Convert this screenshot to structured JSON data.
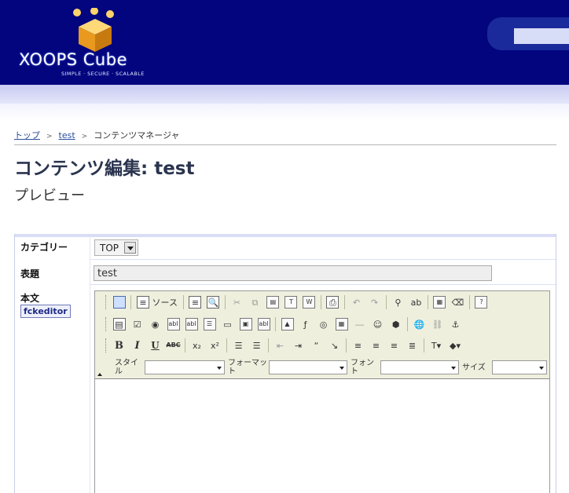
{
  "header": {
    "logo_text": "XOOPS Cube",
    "logo_tagline": "SIMPLE · SECURE · SCALABLE"
  },
  "breadcrumb": {
    "items": [
      "トップ",
      "test",
      "コンテンツマネージャ"
    ],
    "separator": ">"
  },
  "page": {
    "title": "コンテンツ編集: test",
    "subtitle": "プレビュー"
  },
  "form": {
    "category_label": "カテゴリー",
    "category_value": "TOP",
    "subject_label": "表題",
    "subject_value": "test",
    "body_label": "本文",
    "editor_badge": "fckeditor"
  },
  "editor": {
    "source_label": "ソース",
    "style_label": "スタイル",
    "format_label": "フォーマット",
    "font_label": "フォント",
    "size_label": "サイズ",
    "style_value": "",
    "format_value": "",
    "font_value": "",
    "size_value": "",
    "content": ""
  },
  "colors": {
    "header_bg": "#02057e",
    "band": "#c9cbf1",
    "toolbar_bg": "#efefde"
  }
}
